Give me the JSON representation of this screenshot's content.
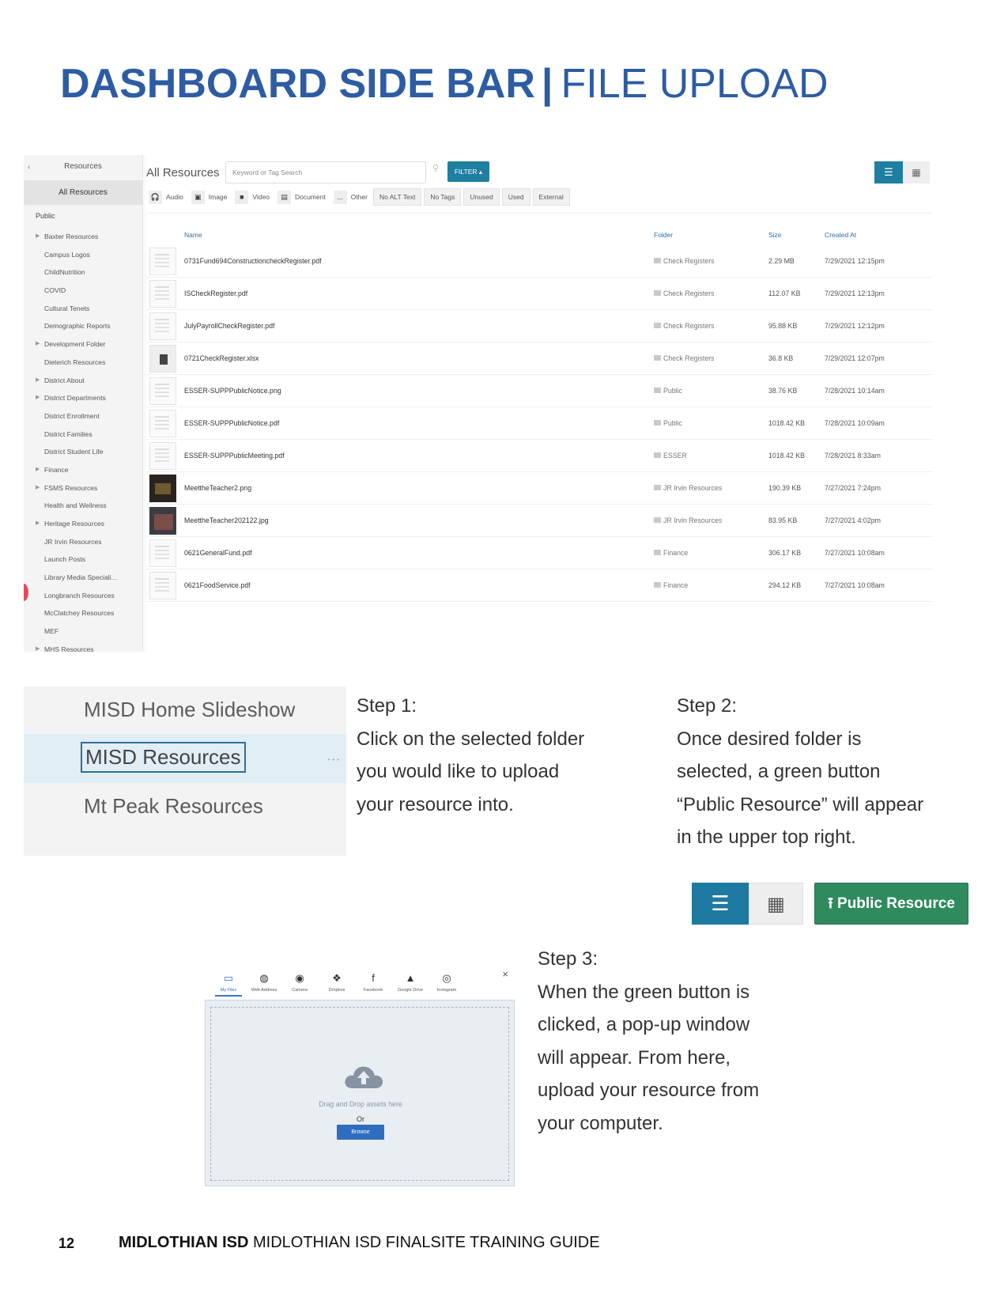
{
  "title": {
    "bold": "DASHBOARD SIDE BAR",
    "separator": "|",
    "light": "FILE UPLOAD"
  },
  "dashboard": {
    "sidebar": {
      "back": "‹",
      "title": "Resources",
      "active": "All Resources",
      "public": "Public",
      "items": [
        {
          "label": "Baxter Resources",
          "caret": "▶"
        },
        {
          "label": "Campus Logos",
          "caret": ""
        },
        {
          "label": "ChildNutrition",
          "caret": ""
        },
        {
          "label": "COVID",
          "caret": ""
        },
        {
          "label": "Cultural Tenets",
          "caret": ""
        },
        {
          "label": "Demographic Reports",
          "caret": ""
        },
        {
          "label": "Development Folder",
          "caret": "▶"
        },
        {
          "label": "Dieterich Resources",
          "caret": ""
        },
        {
          "label": "District About",
          "caret": "▶"
        },
        {
          "label": "District Departments",
          "caret": "▶"
        },
        {
          "label": "District Enrollment",
          "caret": ""
        },
        {
          "label": "District Families",
          "caret": ""
        },
        {
          "label": "District Student Life",
          "caret": ""
        },
        {
          "label": "Finance",
          "caret": "▶"
        },
        {
          "label": "FSMS Resources",
          "caret": "▶"
        },
        {
          "label": "Health and Wellness",
          "caret": ""
        },
        {
          "label": "Heritage Resources",
          "caret": "▶"
        },
        {
          "label": "JR Irvin Resources",
          "caret": ""
        },
        {
          "label": "Launch Posts",
          "caret": ""
        },
        {
          "label": "Library Media Speciali...",
          "caret": ""
        },
        {
          "label": "Longbranch Resources",
          "caret": ""
        },
        {
          "label": "McClatchey Resources",
          "caret": ""
        },
        {
          "label": "MEF",
          "caret": ""
        },
        {
          "label": "MHS Resources",
          "caret": "▶"
        }
      ]
    },
    "main": {
      "title": "All Resources",
      "search_placeholder": "Keyword or Tag Search",
      "filter_button": "FILTER ▴",
      "view_list_icon": "☰",
      "view_grid_icon": "▦",
      "types": [
        {
          "icon": "🎧",
          "label": "Audio"
        },
        {
          "icon": "▣",
          "label": "Image"
        },
        {
          "icon": "■",
          "label": "Video"
        },
        {
          "icon": "▤",
          "label": "Document"
        },
        {
          "icon": "...",
          "label": "Other"
        }
      ],
      "tags": [
        "No ALT Text",
        "No Tags",
        "Unused",
        "Used",
        "External"
      ],
      "columns": {
        "name": "Name",
        "folder": "Folder",
        "size": "Size",
        "created": "Created At"
      },
      "rows": [
        {
          "name": "0731Fund694ConstructioncheckRegister.pdf",
          "folder": "Check Registers",
          "size": "2.29 MB",
          "created": "7/29/2021 12:15pm",
          "thumb": "doc"
        },
        {
          "name": "ISCheckRegister.pdf",
          "folder": "Check Registers",
          "size": "112.07 KB",
          "created": "7/29/2021 12:13pm",
          "thumb": "doc"
        },
        {
          "name": "JulyPayrollCheckRegister.pdf",
          "folder": "Check Registers",
          "size": "95.88 KB",
          "created": "7/29/2021 12:12pm",
          "thumb": "doc"
        },
        {
          "name": "0721CheckRegister.xlsx",
          "folder": "Check Registers",
          "size": "36.8 KB",
          "created": "7/29/2021 12:07pm",
          "thumb": "file"
        },
        {
          "name": "ESSER-SUPPPublicNotice.png",
          "folder": "Public",
          "size": "38.76 KB",
          "created": "7/28/2021 10:14am",
          "thumb": "doc"
        },
        {
          "name": "ESSER-SUPPPublicNotice.pdf",
          "folder": "Public",
          "size": "1018.42 KB",
          "created": "7/28/2021 10:09am",
          "thumb": "doc"
        },
        {
          "name": "ESSER-SUPPPublicMeeting.pdf",
          "folder": "ESSER",
          "size": "1018.42 KB",
          "created": "7/28/2021 8:33am",
          "thumb": "doc"
        },
        {
          "name": "MeettheTeacher2.png",
          "folder": "JR Irvin Resources",
          "size": "190.39 KB",
          "created": "7/27/2021 7:24pm",
          "thumb": "photo"
        },
        {
          "name": "MeettheTeacher202122.jpg",
          "folder": "JR Irvin Resources",
          "size": "83.95 KB",
          "created": "7/27/2021 4:02pm",
          "thumb": "photo2"
        },
        {
          "name": "0621GeneralFund.pdf",
          "folder": "Finance",
          "size": "306.17 KB",
          "created": "7/27/2021 10:08am",
          "thumb": "doc"
        },
        {
          "name": "0621FoodService.pdf",
          "folder": "Finance",
          "size": "294.12 KB",
          "created": "7/27/2021 10:08am",
          "thumb": "doc"
        }
      ]
    }
  },
  "step1_image": {
    "items": [
      "MISD Home Slideshow",
      "MISD Resources",
      "Mt Peak Resources"
    ],
    "dots": "•••"
  },
  "step1": {
    "heading": "Step 1:",
    "lines": [
      "Click on the selected folder",
      "you would like to upload",
      "your resource into."
    ]
  },
  "step2": {
    "heading": "Step 2:",
    "lines": [
      "Once desired folder is",
      "selected, a green button",
      "“Public Resource” will appear",
      "in the upper top right."
    ]
  },
  "step2_buttons": {
    "list_icon": "☰",
    "grid_icon": "▦",
    "public_icon": "⭱",
    "public_label": "Public Resource"
  },
  "upload": {
    "tabs": [
      {
        "icon": "▭",
        "label": "My Files"
      },
      {
        "icon": "◍",
        "label": "Web Address"
      },
      {
        "icon": "◉",
        "label": "Camera"
      },
      {
        "icon": "❖",
        "label": "Dropbox"
      },
      {
        "icon": "f",
        "label": "Facebook"
      },
      {
        "icon": "▲",
        "label": "Google Drive"
      },
      {
        "icon": "◎",
        "label": "Instagram"
      }
    ],
    "close": "×",
    "drag_text": "Drag and Drop assets here",
    "or_text": "Or",
    "browse_label": "Browse"
  },
  "step3": {
    "heading": "Step 3:",
    "lines": [
      "When the green button is",
      "clicked, a pop-up window",
      "will appear. From here,",
      "upload your resource from",
      "your computer."
    ]
  },
  "footer": {
    "page": "12",
    "org_bold": "MIDLOTHIAN ISD",
    "org_rest": "MIDLOTHIAN ISD FINALSITE TRAINING GUIDE"
  }
}
